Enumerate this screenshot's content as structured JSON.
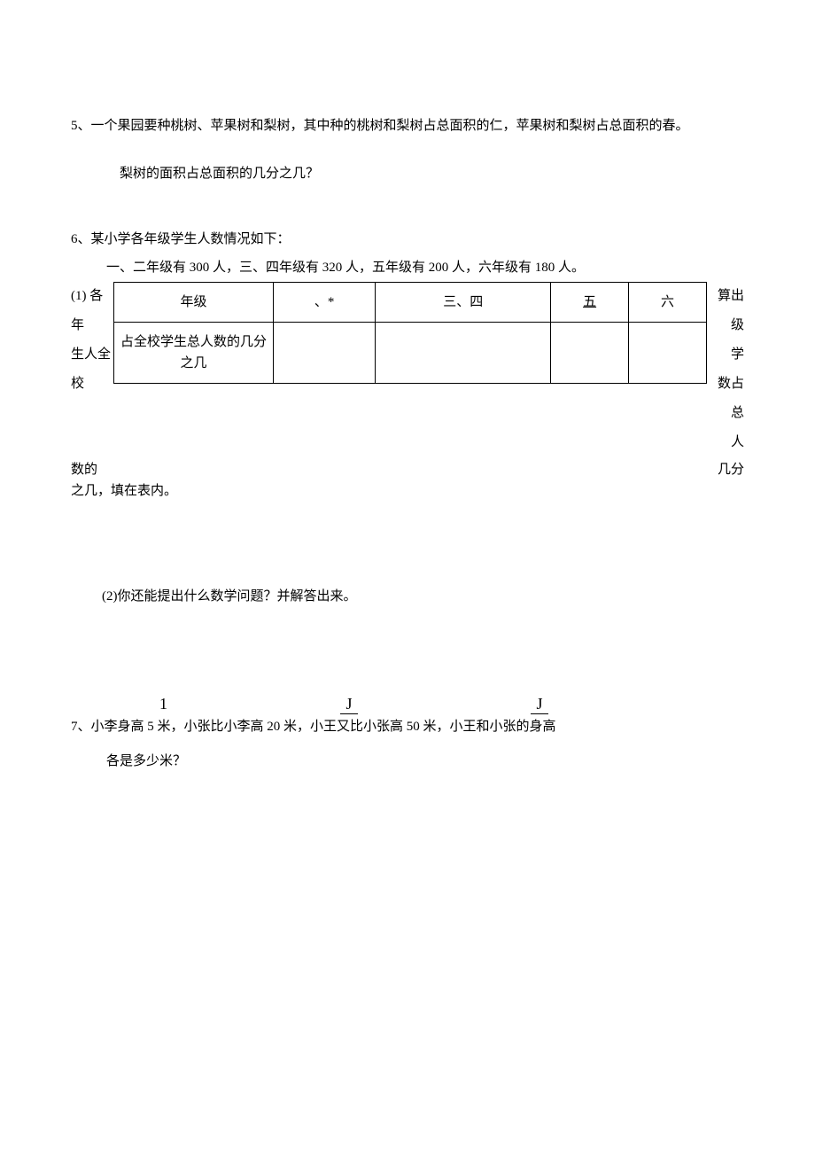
{
  "q5": {
    "line1": "5、一个果园要种桃树、苹果树和梨树，其中种的桃树和梨树占总面积的仁，苹果树和梨树占总面积的春。",
    "line2": "梨树的面积占总面积的几分之几？"
  },
  "q6": {
    "header": "6、某小学各年级学生人数情况如下：",
    "intro": "一、二年级有 300 人，三、四年级有 320 人，五年级有 200 人，六年级有 180 人。",
    "left": {
      "l1": "(1) 各",
      "l2": "年",
      "l3": "生人全",
      "l4": "校",
      "l5": "数的"
    },
    "table": {
      "header": {
        "c0": "年级",
        "c1": "、*",
        "c2": "三、四",
        "c3": "五",
        "c4": "六"
      },
      "row1": {
        "c0": "占全校学生总人数的几分之几"
      }
    },
    "right": {
      "r1": "算出级",
      "r2": "学",
      "r3": "数占总",
      "r4": "人",
      "r5": "几分"
    },
    "tail": "之几，填在表内。",
    "sub2": "(2)你还能提出什么数学问题？并解答出来。"
  },
  "q7": {
    "frac1_top": "1",
    "frac2_top": "J",
    "frac3_top": "J",
    "line1": "7、小李身高 5 米，小张比小李高 20 米，小王又比小张高 50 米，小王和小张的身高",
    "line2": "各是多少米？"
  }
}
